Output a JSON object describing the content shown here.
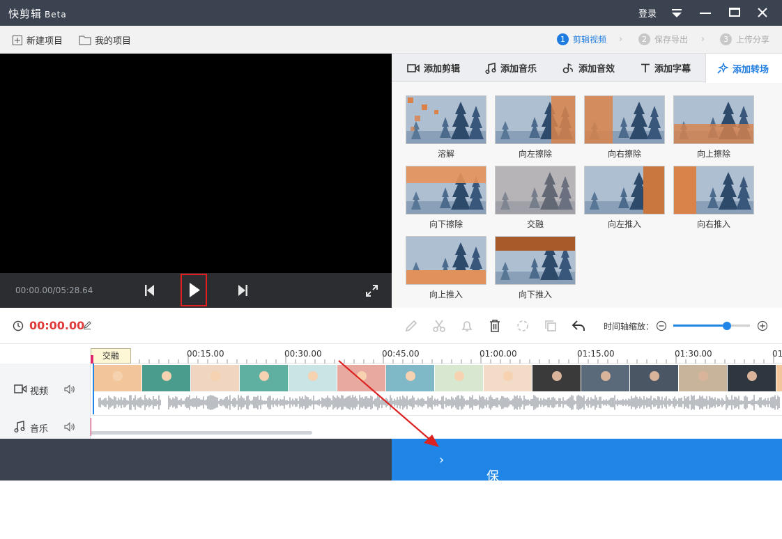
{
  "app": {
    "name": "快剪辑",
    "badge": "Beta",
    "login": "登录"
  },
  "menu": {
    "new_project": "新建项目",
    "my_projects": "我的项目"
  },
  "steps": [
    {
      "num": "1",
      "label": "剪辑视频"
    },
    {
      "num": "2",
      "label": "保存导出"
    },
    {
      "num": "3",
      "label": "上传分享"
    }
  ],
  "player": {
    "time": "00:00.00/05:28.64"
  },
  "tabs": [
    "添加剪辑",
    "添加音乐",
    "添加音效",
    "添加字幕",
    "添加转场"
  ],
  "transitions": [
    "溶解",
    "向左擦除",
    "向右擦除",
    "向上擦除",
    "向下擦除",
    "交融",
    "向左推入",
    "向右推入",
    "向上推入",
    "向下推入"
  ],
  "toolbar": {
    "current_time": "00:00.00",
    "zoom_label": "时间轴缩放："
  },
  "timeline": {
    "ticks": [
      "00:15.00",
      "00:30.00",
      "00:45.00",
      "01:00.00",
      "01:15.00",
      "01:30.00",
      "01"
    ],
    "transition_tag": "交融",
    "video_label": "视频",
    "music_label": "音乐",
    "zoom_level": 0.7
  },
  "export": {
    "label": "保存导出"
  },
  "colors": {
    "accent": "#1f86e8",
    "time_red": "#e03b3b",
    "titlebar": "#3c4350"
  }
}
